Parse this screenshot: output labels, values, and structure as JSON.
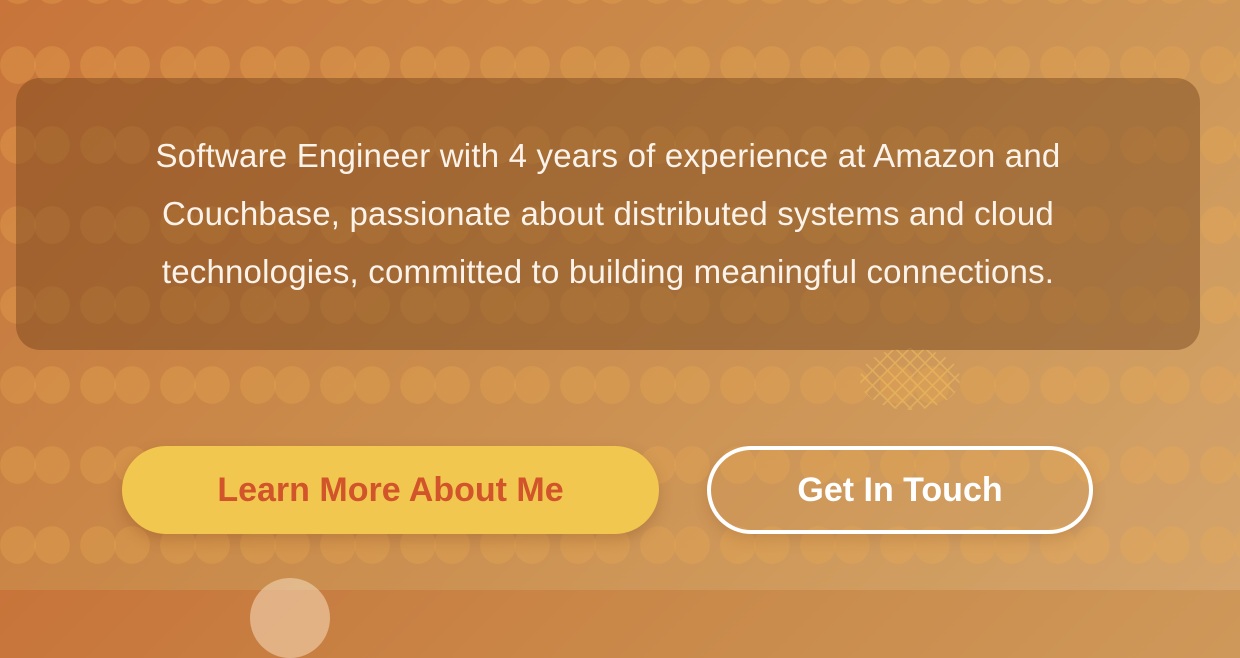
{
  "hero": {
    "bio": "Software Engineer with 4 years of experience at Amazon and Couchbase, passionate about distributed systems and cloud technologies, committed to building meaningful connections."
  },
  "actions": {
    "primary_label": "Learn More About Me",
    "secondary_label": "Get In Touch"
  },
  "colors": {
    "background_start": "#c8743a",
    "background_end": "#d4a46c",
    "primary_button_bg": "#f1c750",
    "primary_button_text": "#d1542a",
    "secondary_button_border": "#ffffff"
  }
}
